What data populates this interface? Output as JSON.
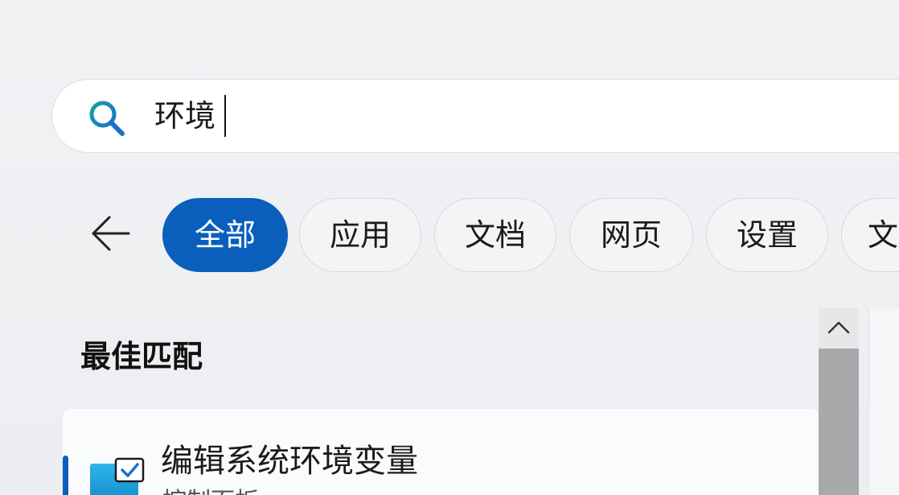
{
  "search": {
    "query": "环境",
    "icon": "search-icon"
  },
  "filters": {
    "back_icon": "arrow-left-icon",
    "chips": [
      {
        "label": "全部",
        "active": true
      },
      {
        "label": "应用",
        "active": false
      },
      {
        "label": "文档",
        "active": false
      },
      {
        "label": "网页",
        "active": false
      },
      {
        "label": "设置",
        "active": false
      },
      {
        "label": "文",
        "active": false
      }
    ]
  },
  "results": {
    "section_title": "最佳匹配",
    "best_match": {
      "title": "编辑系统环境变量",
      "subtitle": "控制面板",
      "icon": "control-panel-icon"
    }
  },
  "colors": {
    "accent": "#0a5fbd",
    "background": "#eef0f3",
    "search_icon_blue": "#1a73c8",
    "search_icon_teal": "#12a3a0"
  }
}
